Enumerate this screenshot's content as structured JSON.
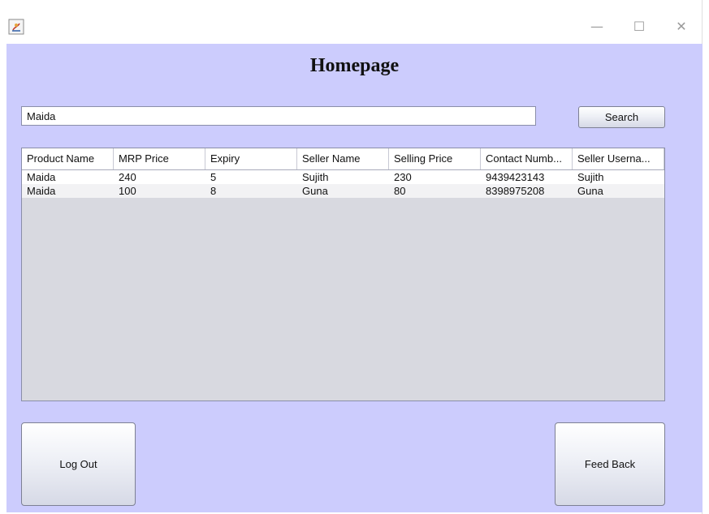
{
  "window": {
    "controls": {
      "minimize": "—",
      "maximize": "☐",
      "close": "✕"
    },
    "icon": "java-app-icon"
  },
  "page": {
    "title": "Homepage"
  },
  "search": {
    "value": "Maida",
    "button_label": "Search"
  },
  "table": {
    "columns": [
      "Product Name",
      "MRP Price",
      "Expiry",
      "Seller Name",
      "Selling Price",
      "Contact Numb...",
      "Seller Userna..."
    ],
    "rows": [
      [
        "Maida",
        "240",
        "5",
        "Sujith",
        "230",
        "9439423143",
        "Sujith"
      ],
      [
        "Maida",
        "100",
        "8",
        "Guna",
        "80",
        "8398975208",
        "Guna"
      ]
    ]
  },
  "actions": {
    "logout_label": "Log Out",
    "feedback_label": "Feed Back"
  },
  "colors": {
    "background": "#ccccfd",
    "table_empty": "#d8d9e0"
  }
}
